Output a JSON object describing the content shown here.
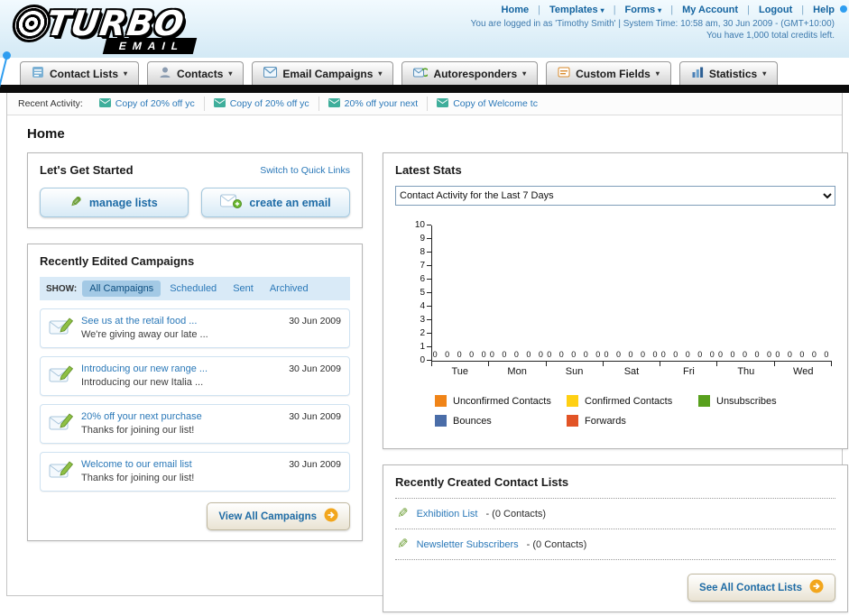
{
  "header": {
    "logo": {
      "word1": "TURBO",
      "word2": "EMAIL"
    },
    "links": [
      {
        "label": "Home",
        "menu": false
      },
      {
        "label": "Templates",
        "menu": true
      },
      {
        "label": "Forms",
        "menu": true
      },
      {
        "label": "My Account",
        "menu": false
      },
      {
        "label": "Logout",
        "menu": false
      },
      {
        "label": "Help",
        "menu": false
      }
    ],
    "session_line": "You are logged in as 'Timothy Smith' | System Time: 10:58 am, 30 Jun 2009 - (GMT+10:00)",
    "credits_line": "You have 1,000 total credits left."
  },
  "nav": {
    "items": [
      {
        "label": "Contact Lists",
        "icon": "contact-lists-icon"
      },
      {
        "label": "Contacts",
        "icon": "contacts-icon"
      },
      {
        "label": "Email Campaigns",
        "icon": "email-campaigns-icon"
      },
      {
        "label": "Autoresponders",
        "icon": "autoresponders-icon"
      },
      {
        "label": "Custom Fields",
        "icon": "custom-fields-icon"
      },
      {
        "label": "Statistics",
        "icon": "statistics-icon"
      }
    ]
  },
  "activity": {
    "label": "Recent Activity:",
    "items": [
      "Copy of 20% off yc",
      "Copy of 20% off yc",
      "20% off your next",
      "Copy of Welcome tc"
    ]
  },
  "page_title": "Home",
  "get_started": {
    "title": "Let's Get Started",
    "switch_link": "Switch to Quick Links",
    "buttons": [
      {
        "label": "manage lists",
        "icon": "pencil-icon"
      },
      {
        "label": "create an email",
        "icon": "envelope-plus-icon"
      }
    ]
  },
  "campaigns": {
    "title": "Recently Edited Campaigns",
    "show_label": "SHOW:",
    "tabs": [
      "All Campaigns",
      "Scheduled",
      "Sent",
      "Archived"
    ],
    "active_tab": "All Campaigns",
    "items": [
      {
        "title": "See us at the retail food ...",
        "subtitle": "We're giving away our late ...",
        "date": "30 Jun 2009"
      },
      {
        "title": "Introducing our new range ...",
        "subtitle": "Introducing our new Italia ...",
        "date": "30 Jun 2009"
      },
      {
        "title": "20% off your next purchase",
        "subtitle": "Thanks for joining our list!",
        "date": "30 Jun 2009"
      },
      {
        "title": "Welcome to our email list",
        "subtitle": "Thanks for joining our list!",
        "date": "30 Jun 2009"
      }
    ],
    "view_all_label": "View All Campaigns"
  },
  "stats": {
    "title": "Latest Stats"
  },
  "chart_data": {
    "type": "bar",
    "title": "Contact Activity for the Last 7 Days",
    "categories": [
      "Tue",
      "Mon",
      "Sun",
      "Sat",
      "Fri",
      "Thu",
      "Wed"
    ],
    "series": [
      {
        "name": "Unconfirmed Contacts",
        "color": "#f08418",
        "values": [
          0,
          0,
          0,
          0,
          0,
          0,
          0
        ]
      },
      {
        "name": "Confirmed Contacts",
        "color": "#ffd013",
        "values": [
          0,
          0,
          0,
          0,
          0,
          0,
          0
        ]
      },
      {
        "name": "Unsubscribes",
        "color": "#58a01d",
        "values": [
          0,
          0,
          0,
          0,
          0,
          0,
          0
        ]
      },
      {
        "name": "Bounces",
        "color": "#4a6da8",
        "values": [
          0,
          0,
          0,
          0,
          0,
          0,
          0
        ]
      },
      {
        "name": "Forwards",
        "color": "#e25426",
        "values": [
          0,
          0,
          0,
          0,
          0,
          0,
          0
        ]
      }
    ],
    "ylim": [
      0,
      10
    ],
    "ytick_step": 1,
    "grid": false,
    "legend_position": "bottom",
    "value_labels": true,
    "xlabel": "",
    "ylabel": ""
  },
  "contact_lists": {
    "title": "Recently Created Contact Lists",
    "items": [
      {
        "name": "Exhibition List",
        "detail": "- (0 Contacts)"
      },
      {
        "name": "Newsletter Subscribers",
        "detail": "- (0 Contacts)"
      }
    ],
    "see_all_label": "See All Contact Lists"
  }
}
